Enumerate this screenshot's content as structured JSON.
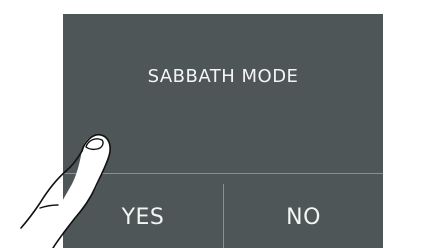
{
  "dialog": {
    "title": "SABBATH MODE",
    "yes_label": "YES",
    "no_label": "NO"
  },
  "colors": {
    "panel_background": "#4f5657",
    "text": "#f4f4f4",
    "divider": "#8a9091",
    "page_background": "#ffffff"
  },
  "icons": {
    "pointer": "pointing-hand-icon"
  }
}
